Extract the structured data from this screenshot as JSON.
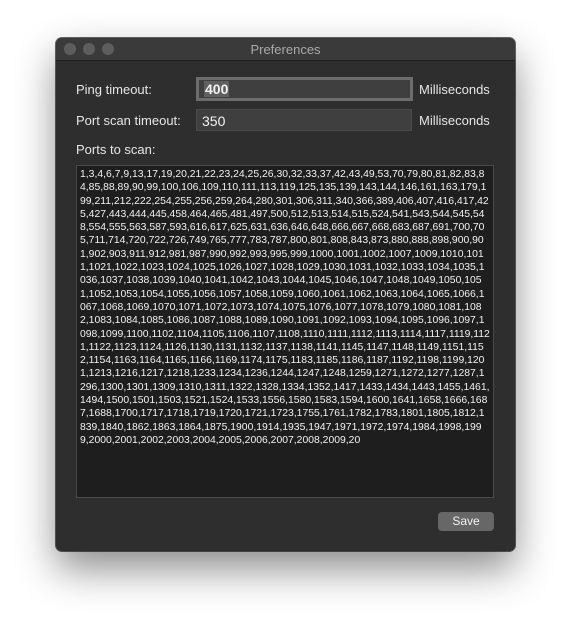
{
  "window": {
    "title": "Preferences"
  },
  "ping": {
    "label": "Ping timeout:",
    "value": "400",
    "unit": "Milliseconds"
  },
  "portscan": {
    "label": "Port scan timeout:",
    "value": "350",
    "unit": "Milliseconds"
  },
  "ports": {
    "label": "Ports to scan:",
    "value": "1,3,4,6,7,9,13,17,19,20,21,22,23,24,25,26,30,32,33,37,42,43,49,53,70,79,80,81,82,83,84,85,88,89,90,99,100,106,109,110,111,113,119,125,135,139,143,144,146,161,163,179,199,211,212,222,254,255,256,259,264,280,301,306,311,340,366,389,406,407,416,417,425,427,443,444,445,458,464,465,481,497,500,512,513,514,515,524,541,543,544,545,548,554,555,563,587,593,616,617,625,631,636,646,648,666,667,668,683,687,691,700,705,711,714,720,722,726,749,765,777,783,787,800,801,808,843,873,880,888,898,900,901,902,903,911,912,981,987,990,992,993,995,999,1000,1001,1002,1007,1009,1010,1011,1021,1022,1023,1024,1025,1026,1027,1028,1029,1030,1031,1032,1033,1034,1035,1036,1037,1038,1039,1040,1041,1042,1043,1044,1045,1046,1047,1048,1049,1050,1051,1052,1053,1054,1055,1056,1057,1058,1059,1060,1061,1062,1063,1064,1065,1066,1067,1068,1069,1070,1071,1072,1073,1074,1075,1076,1077,1078,1079,1080,1081,1082,1083,1084,1085,1086,1087,1088,1089,1090,1091,1092,1093,1094,1095,1096,1097,1098,1099,1100,1102,1104,1105,1106,1107,1108,1110,1111,1112,1113,1114,1117,1119,1121,1122,1123,1124,1126,1130,1131,1132,1137,1138,1141,1145,1147,1148,1149,1151,1152,1154,1163,1164,1165,1166,1169,1174,1175,1183,1185,1186,1187,1192,1198,1199,1201,1213,1216,1217,1218,1233,1234,1236,1244,1247,1248,1259,1271,1272,1277,1287,1296,1300,1301,1309,1310,1311,1322,1328,1334,1352,1417,1433,1434,1443,1455,1461,1494,1500,1501,1503,1521,1524,1533,1556,1580,1583,1594,1600,1641,1658,1666,1687,1688,1700,1717,1718,1719,1720,1721,1723,1755,1761,1782,1783,1801,1805,1812,1839,1840,1862,1863,1864,1875,1900,1914,1935,1947,1971,1972,1974,1984,1998,1999,2000,2001,2002,2003,2004,2005,2006,2007,2008,2009,20"
  },
  "buttons": {
    "save": "Save"
  }
}
